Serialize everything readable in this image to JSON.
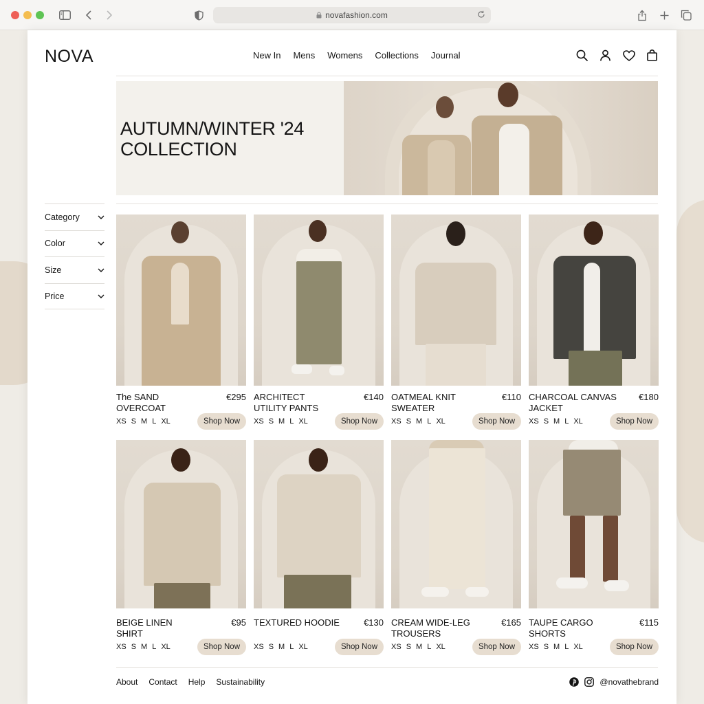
{
  "browser": {
    "url": "novafashion.com"
  },
  "brand": {
    "logo": "NOVA"
  },
  "nav": {
    "items": [
      {
        "label": "New In"
      },
      {
        "label": "Mens"
      },
      {
        "label": "Womens"
      },
      {
        "label": "Collections"
      },
      {
        "label": "Journal"
      }
    ]
  },
  "header_icons": [
    "search-icon",
    "account-icon",
    "wishlist-heart-icon",
    "bag-icon"
  ],
  "hero": {
    "title_line1": "AUTUMN/WINTER '24",
    "title_line2": "COLLECTION"
  },
  "filters": [
    {
      "label": "Category"
    },
    {
      "label": "Color"
    },
    {
      "label": "Size"
    },
    {
      "label": "Price"
    }
  ],
  "products": [
    {
      "name_line1": "The SAND",
      "name_line2": "OVERCOAT",
      "price": "€295"
    },
    {
      "name_line1": "ARCHITECT",
      "name_line2": "UTILITY PANTS",
      "price": "€140"
    },
    {
      "name_line1": "OATMEAL KNIT",
      "name_line2": "SWEATER",
      "price": "€110"
    },
    {
      "name_line1": "CHARCOAL CANVAS",
      "name_line2": "JACKET",
      "price": "€180"
    },
    {
      "name_line1": "BEIGE LINEN",
      "name_line2": "SHIRT",
      "price": "€95"
    },
    {
      "name_line1": "TEXTURED HOODIE",
      "name_line2": "",
      "price": "€130"
    },
    {
      "name_line1": "CREAM WIDE-LEG",
      "name_line2": "TROUSERS",
      "price": "€165"
    },
    {
      "name_line1": "TAUPE CARGO",
      "name_line2": "SHORTS",
      "price": "€115"
    }
  ],
  "sizes": [
    "XS",
    "S",
    "M",
    "L",
    "XL"
  ],
  "shop_label": "Shop Now",
  "footer": {
    "links": [
      {
        "label": "About"
      },
      {
        "label": "Contact"
      },
      {
        "label": "Help"
      },
      {
        "label": "Sustainability"
      }
    ],
    "social_handle": "@novathebrand"
  },
  "colors": {
    "page_bg": "#ffffff",
    "hero_bg": "#f3f1ec",
    "button_bg": "#e7ddd0",
    "text": "#141414"
  }
}
